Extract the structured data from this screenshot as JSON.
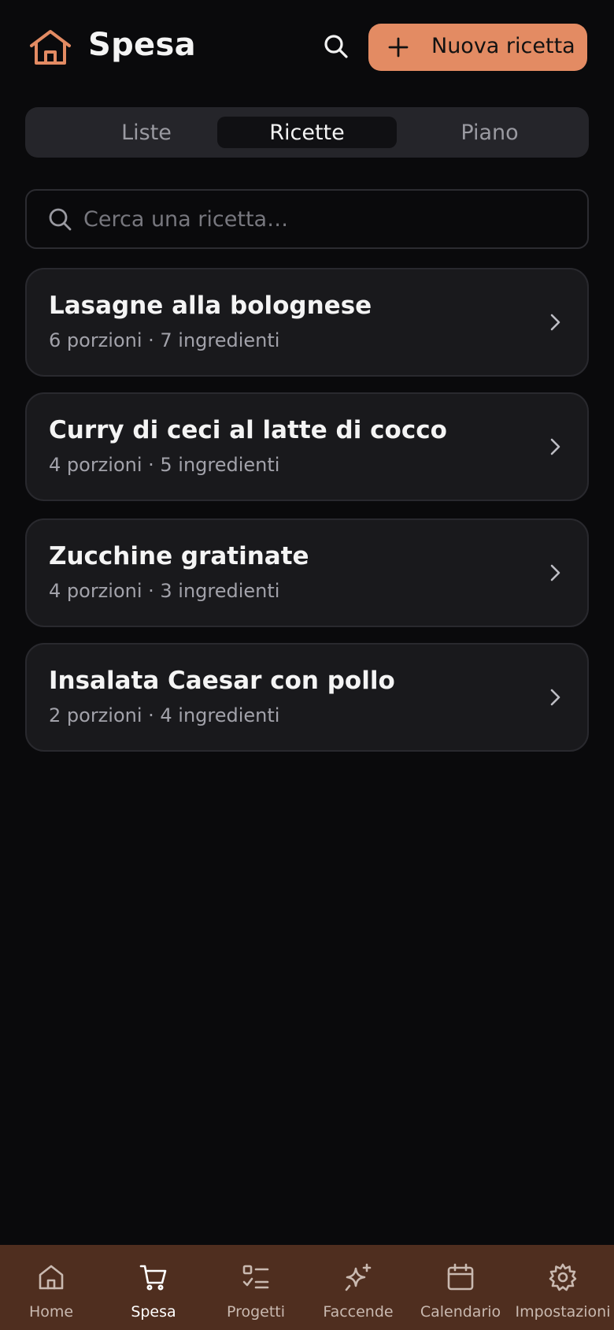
{
  "header": {
    "title": "Spesa",
    "logo_icon": "house-icon",
    "search_icon": "search-icon",
    "new_button_label": "Nuova ricetta",
    "accent_color": "#e38b63"
  },
  "tabs": [
    {
      "label": "Liste",
      "selected": false
    },
    {
      "label": "Ricette",
      "selected": true
    },
    {
      "label": "Piano",
      "selected": false
    }
  ],
  "search": {
    "placeholder": "Cerca una ricetta…",
    "value": ""
  },
  "recipes": [
    {
      "name": "Lasagne alla bolognese",
      "meta": "6 porzioni · 7 ingredienti"
    },
    {
      "name": "Curry di ceci al latte di cocco",
      "meta": "4 porzioni · 5 ingredienti"
    },
    {
      "name": "Zucchine gratinate",
      "meta": "4 porzioni · 3 ingredienti"
    },
    {
      "name": "Insalata Caesar con pollo",
      "meta": "2 porzioni · 4 ingredienti"
    }
  ],
  "bottom_nav": {
    "background": "#4f2e1f",
    "items": [
      {
        "label": "Home",
        "icon": "home-icon",
        "active": false
      },
      {
        "label": "Spesa",
        "icon": "cart-icon",
        "active": true
      },
      {
        "label": "Progetti",
        "icon": "checklist-icon",
        "active": false
      },
      {
        "label": "Faccende",
        "icon": "sparkles-icon",
        "active": false
      },
      {
        "label": "Calendario",
        "icon": "calendar-icon",
        "active": false
      },
      {
        "label": "Impostazioni",
        "icon": "gear-icon",
        "active": false
      }
    ]
  }
}
